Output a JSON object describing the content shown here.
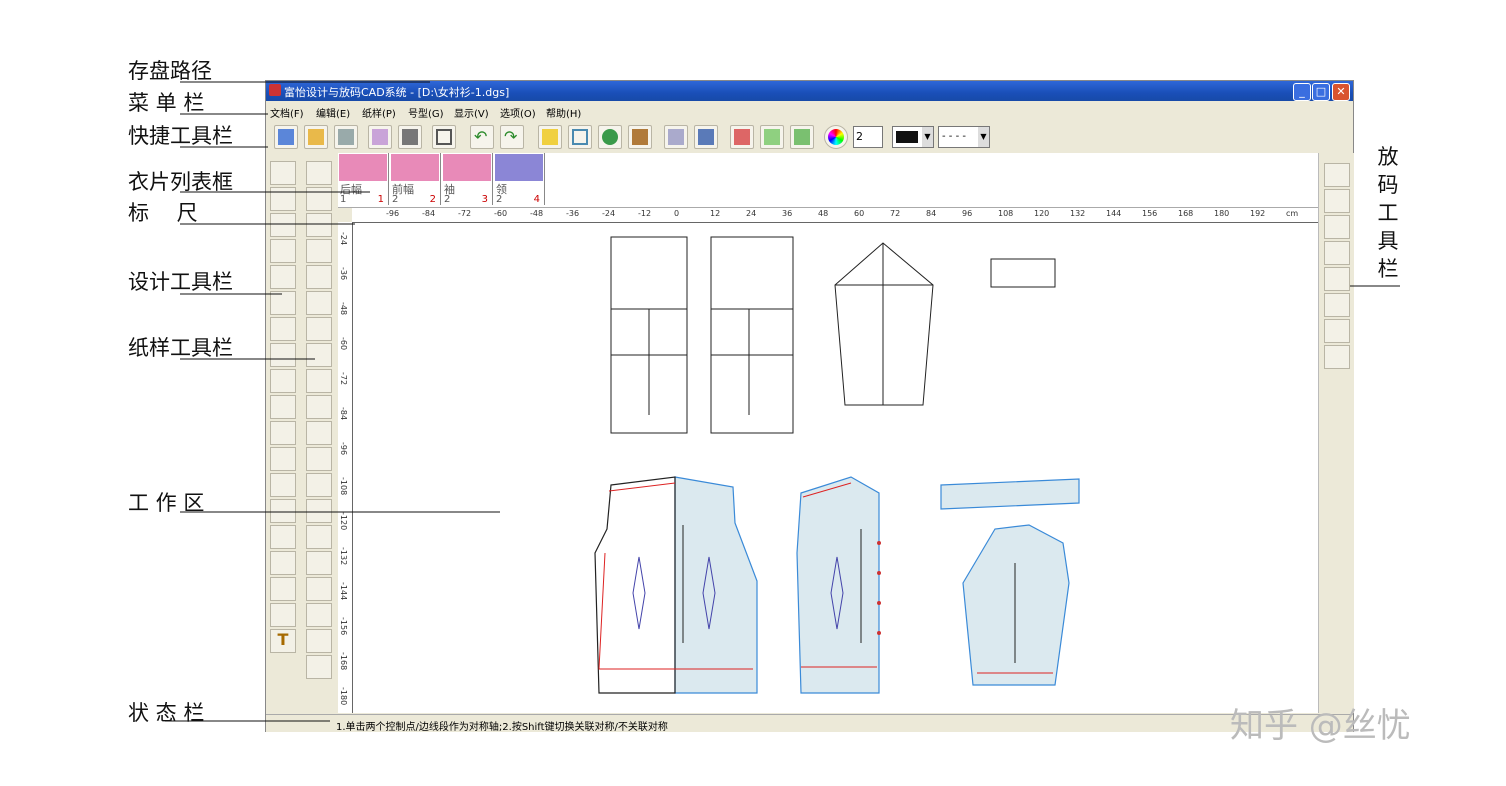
{
  "annotations": {
    "save_path": "存盘路径",
    "menu_bar": "菜 单 栏",
    "quick_toolbar": "快捷工具栏",
    "piece_list": "衣片列表框",
    "ruler": "标　 尺",
    "design_toolbar": "设计工具栏",
    "pattern_toolbar": "纸样工具栏",
    "work_area": "工 作 区",
    "status_bar": "状 态 栏",
    "grading_toolbar": "放码工具栏"
  },
  "window": {
    "title": "富怡设计与放码CAD系统 - [D:\\女衬衫-1.dgs]",
    "menu": [
      "文档(F)",
      "编辑(E)",
      "纸样(P)",
      "号型(G)",
      "显示(V)",
      "选项(O)",
      "帮助(H)"
    ],
    "toolbar_line_width": "2",
    "line_style": "- - - -"
  },
  "pieces": [
    {
      "name": "后幅",
      "count": "1",
      "index": "1"
    },
    {
      "name": "前幅",
      "count": "2",
      "index": "2"
    },
    {
      "name": "袖",
      "count": "2",
      "index": "3"
    },
    {
      "name": "领",
      "count": "2",
      "index": "4"
    }
  ],
  "ruler_h": [
    "-96",
    "-84",
    "-72",
    "-60",
    "-48",
    "-36",
    "-24",
    "-12",
    "0",
    "12",
    "24",
    "36",
    "48",
    "60",
    "72",
    "84",
    "96",
    "108",
    "120",
    "132",
    "144",
    "156",
    "168",
    "180",
    "192",
    "cm"
  ],
  "ruler_v": [
    "-24",
    "-36",
    "-48",
    "-60",
    "-72",
    "-84",
    "-96",
    "-108",
    "-120",
    "-132",
    "-144",
    "-156",
    "-168",
    "-180"
  ],
  "status_text": "1.单击两个控制点/边线段作为对称轴;2.按Shift键切换关联对称/不关联对称",
  "watermark": "知乎 @丝忧",
  "colors": {
    "title_bar": "#1a4fb8",
    "piece_pink": "#e88ab8",
    "piece_purple": "#8b86d6",
    "grade_red": "#d22",
    "grade_blue": "#3a8ad8",
    "piece_fill": "#dbe9ef"
  }
}
